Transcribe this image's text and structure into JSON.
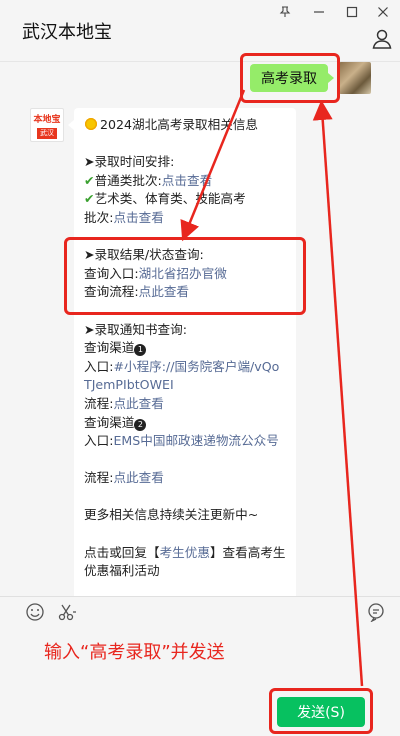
{
  "window": {
    "title": "武汉本地宝",
    "pin_icon": "pin-icon",
    "minimize_icon": "minimize-icon",
    "maximize_icon": "maximize-icon",
    "close_icon": "close-icon",
    "profile_icon": "person-icon"
  },
  "chat": {
    "my_message": "高考录取",
    "sender_logo": {
      "top": "本地宝",
      "bottom": "武汉"
    },
    "reply": {
      "heading": "2024湖北高考录取相关信息",
      "schedule_title": "➤录取时间安排:",
      "general_label": "普通类批次:",
      "general_link": "点击查看",
      "arts_label": "艺术类、体育类、技能高考",
      "arts_label2": "批次:",
      "arts_link": "点击查看",
      "result_title": "➤录取结果/状态查询:",
      "result_entry_label": "查询入口:",
      "result_entry_link": "湖北省招办官微",
      "result_flow_label": "查询流程:",
      "result_flow_link": "点此查看",
      "notice_title": "➤录取通知书查询:",
      "channel1_label": "查询渠道",
      "channel1_num": "1",
      "channel1_entry_label": "入口:",
      "channel1_entry_link": "#小程序://国务院客户端/vQoTJemPIbtOWEI",
      "channel1_flow_label": "流程:",
      "channel1_flow_link": "点此查看",
      "channel2_label": "查询渠道",
      "channel2_num": "2",
      "channel2_entry_label": "入口:",
      "channel2_entry_link": "EMS中国邮政速递物流公众号",
      "channel2_flow_label": "流程:",
      "channel2_flow_link": "点此查看",
      "more_info": "更多相关信息持续关注更新中~",
      "reply_prefix": "点击或回复【",
      "reply_link": "考生优惠",
      "reply_suffix": "】查看高考生优惠福利活动"
    }
  },
  "input": {
    "emoji_icon": "emoji-icon",
    "scissors_icon": "scissors-icon",
    "chat_bubble_icon": "chat-bubble-icon",
    "instruction": "输入“高考录取”并发送",
    "send_label": "发送(S)"
  },
  "colors": {
    "accent_red": "#e8261e",
    "bubble_green": "#95ec69",
    "link_blue": "#576b95",
    "send_green": "#07c160"
  }
}
